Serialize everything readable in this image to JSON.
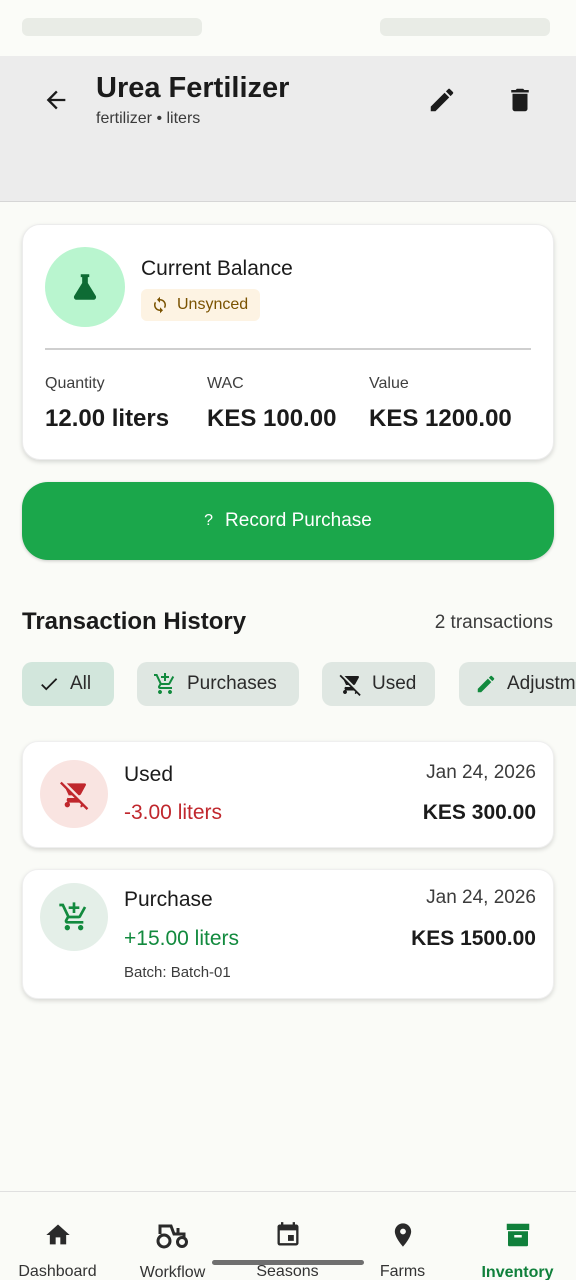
{
  "header": {
    "title": "Urea Fertilizer",
    "subtitle": "fertilizer • liters"
  },
  "balance": {
    "title": "Current Balance",
    "sync_status": "Unsynced",
    "stats": [
      {
        "label": "Quantity",
        "value": "12.00 liters"
      },
      {
        "label": "WAC",
        "value": "KES 100.00"
      },
      {
        "label": "Value",
        "value": "KES 1200.00"
      }
    ]
  },
  "record_button": {
    "icon_text": "?",
    "label": "Record Purchase"
  },
  "history": {
    "title": "Transaction History",
    "count": "2 transactions",
    "filters": [
      "All",
      "Purchases",
      "Used",
      "Adjustm"
    ],
    "transactions": [
      {
        "type": "Used",
        "quantity": "-3.00 liters",
        "date": "Jan 24, 2026",
        "amount": "KES 300.00",
        "icon": "remove-shopping-cart-icon"
      },
      {
        "type": "Purchase",
        "quantity": "+15.00 liters",
        "date": "Jan 24, 2026",
        "amount": "KES 1500.00",
        "batch": "Batch: Batch-01",
        "icon": "add-shopping-cart-icon"
      }
    ]
  },
  "nav": {
    "items": [
      "Dashboard",
      "Workflow",
      "Seasons",
      "Farms",
      "Inventory"
    ],
    "active": "Inventory"
  },
  "colors": {
    "accent": "#1ba74b",
    "negative": "#c0272d",
    "positive": "#128a3e",
    "active_nav": "#10803b"
  }
}
